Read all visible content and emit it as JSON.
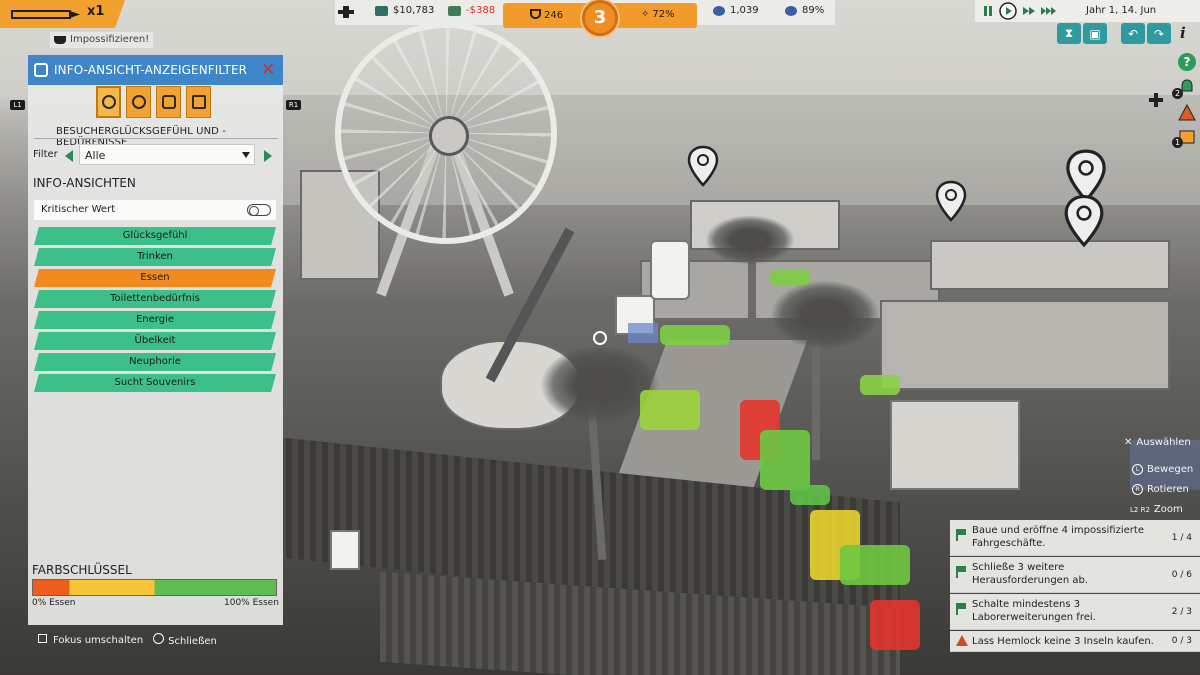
{
  "hud": {
    "pencil_count": "x1",
    "impossible_button": "Impossifizieren!",
    "money": "$10,783",
    "money_delta": "-$388",
    "research": "246",
    "level": "3",
    "progress": "72%",
    "guests": "1,039",
    "happiness": "89%",
    "date": "Jahr 1, 14. Jun",
    "l1_hint": "L1",
    "r1_hint": "R1",
    "side_badge_1": "2",
    "side_badge_2": "1"
  },
  "panel": {
    "title": "INFO-ANSICHT-ANZEIGENFILTER",
    "subtitle": "BESUCHERGLÜCKSGEFÜHL UND -BEDÜRFNISSE",
    "filter_label": "Filter",
    "filter_value": "Alle",
    "section_title": "INFO-ANSICHTEN",
    "critical_toggle": "Kritischer Wert",
    "views": [
      "Glücksgefühl",
      "Trinken",
      "Essen",
      "Toilettenbedürfnis",
      "Energie",
      "Übelkeit",
      "Neuphorie",
      "Sucht Souvenirs"
    ],
    "selected_view": "Essen",
    "color_key_title": "FARBSCHLÜSSEL",
    "color_key_min": "0% Essen",
    "color_key_max": "100% Essen"
  },
  "bottom_hints": {
    "focus": "Fokus umschalten",
    "close": "Schließen"
  },
  "controls": {
    "select": "Auswählen",
    "move": "Bewegen",
    "rotate": "Rotieren",
    "zoom": "Zoom",
    "move_key": "L",
    "rotate_key": "R",
    "zoom_keys": "L2  R2"
  },
  "objectives": [
    {
      "text": "Baue und eröffne 4 impossifizierte Fahrgeschäfte.",
      "count": "1 / 4"
    },
    {
      "text": "Schließe 3 weitere Herausforderungen  ab.",
      "count": "0 / 6"
    },
    {
      "text": "Schalte mindestens 3 Laborerweiterungen  frei.",
      "count": "2 / 3"
    },
    {
      "text": "Lass Hemlock keine 3 Inseln kaufen.",
      "count": "0 / 3"
    }
  ],
  "colors": {
    "panel_header": "#3d86c8",
    "view_button": "#3dbf8a",
    "view_selected": "#f28b1f",
    "hud_orange": "#f29a2a",
    "money_negative": "#d0342c",
    "tool_teal": "#2f9a9f"
  },
  "icons": [
    "pencil-icon",
    "gamepad-icon",
    "money-icon",
    "research-icon",
    "guests-icon",
    "happiness-icon",
    "pause-icon",
    "play-icon",
    "fast-forward-icon",
    "hourglass-icon",
    "camera-icon",
    "undo-icon",
    "redo-icon",
    "info-icon",
    "help-icon",
    "alert-icon"
  ]
}
